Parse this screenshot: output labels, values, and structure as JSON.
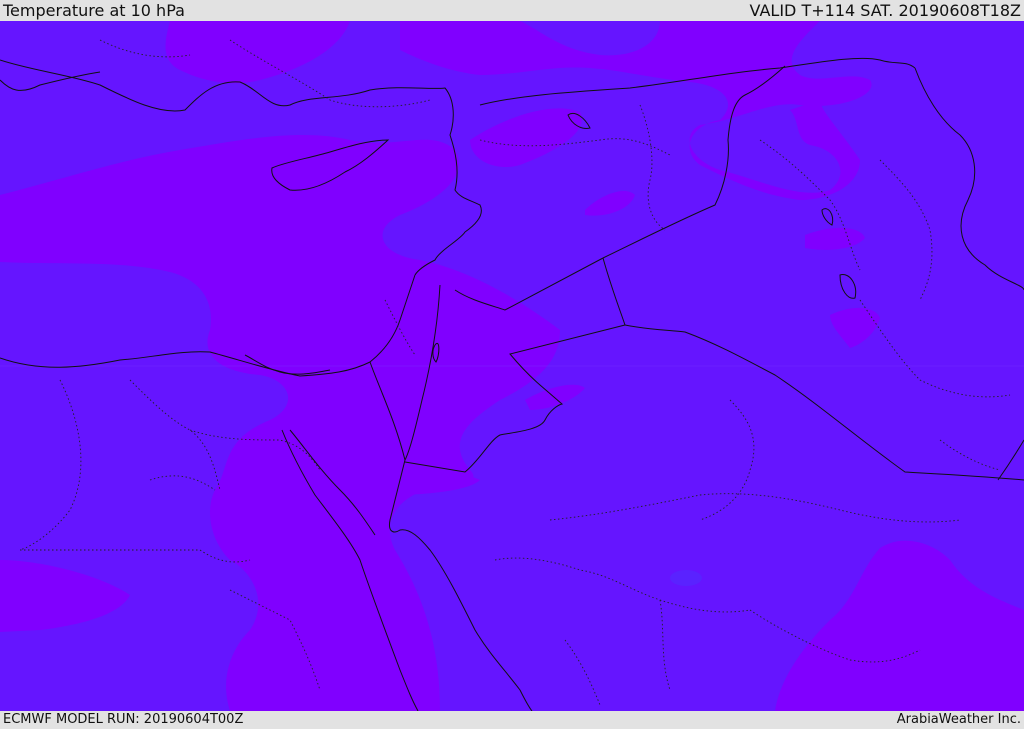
{
  "header": {
    "title": "Temperature at 10 hPa",
    "valid_time": "VALID T+114 SAT. 20190608T18Z"
  },
  "footer": {
    "model_run": "ECMWF MODEL RUN: 20190604T00Z",
    "credit": "ArabiaWeather Inc."
  },
  "map": {
    "colors": {
      "cooler_band": "#6515ff",
      "warmer_band": "#8000ff",
      "border_line": "#111111"
    }
  }
}
